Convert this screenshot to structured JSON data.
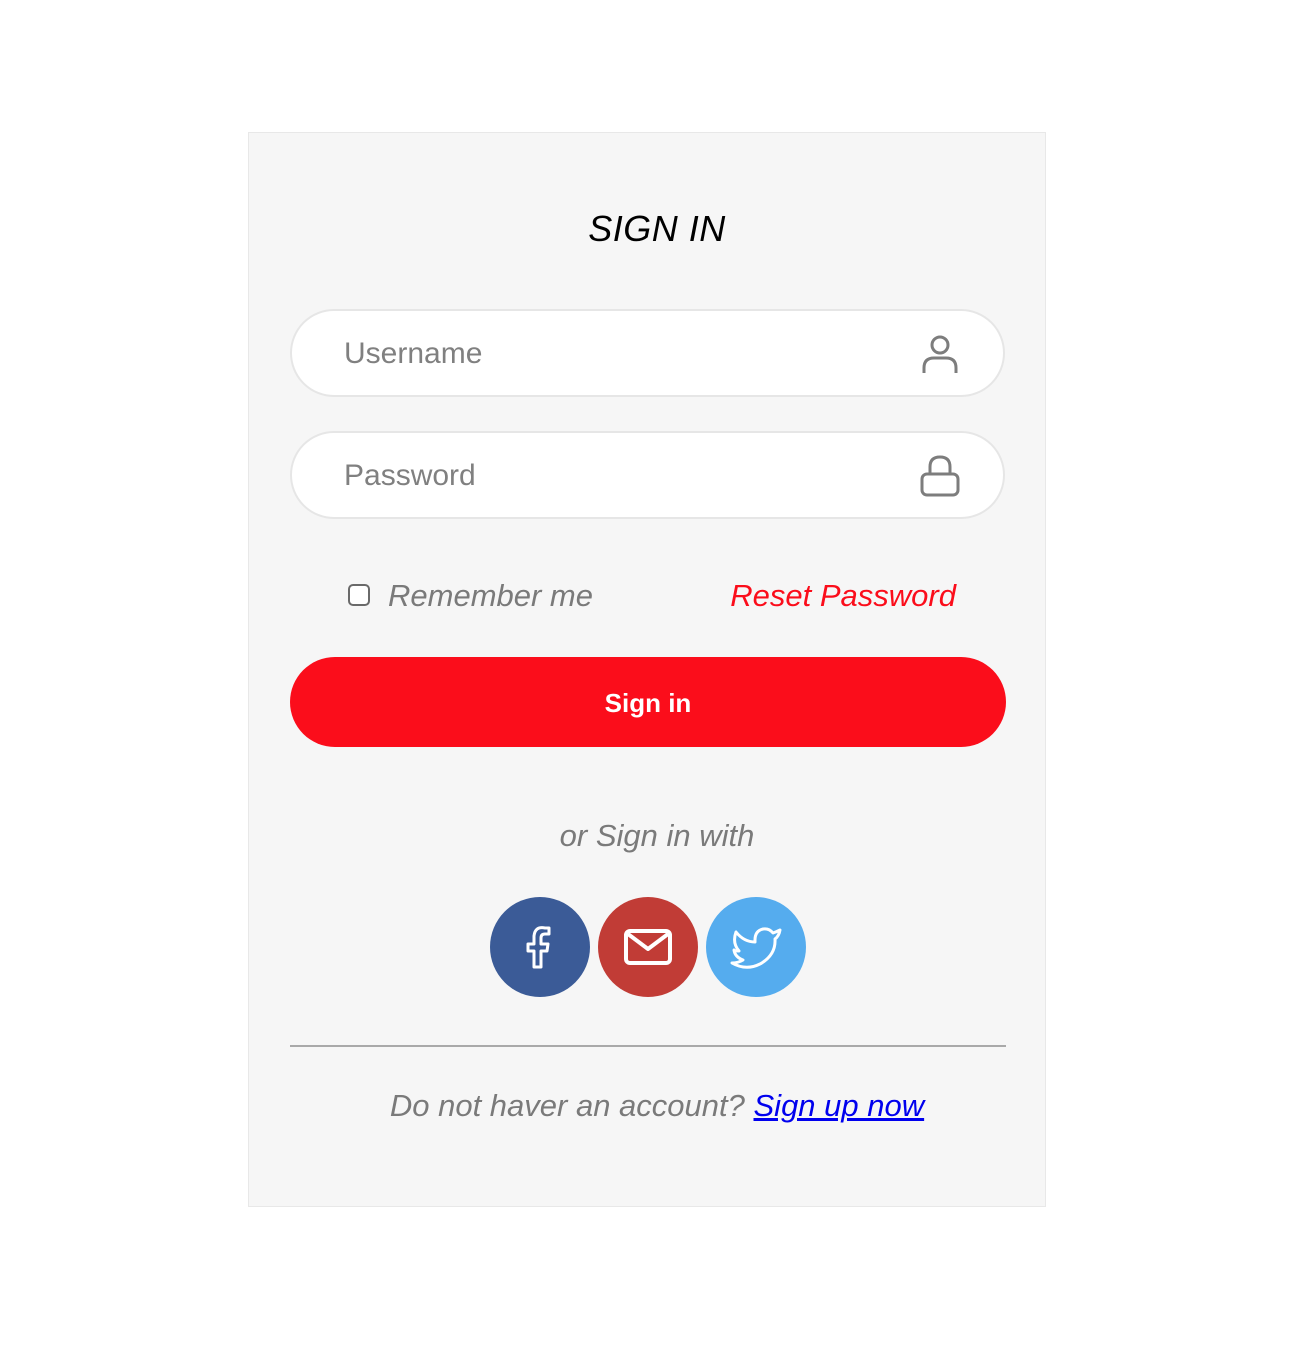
{
  "form": {
    "title": "SIGN IN",
    "username": {
      "placeholder": "Username",
      "icon": "user-icon"
    },
    "password": {
      "placeholder": "Password",
      "icon": "lock-icon"
    },
    "remember_label": "Remember me",
    "remember_checked": false,
    "reset_label": "Reset Password",
    "submit_label": "Sign in",
    "or_label": "or Sign in with",
    "social": [
      {
        "name": "facebook",
        "icon": "facebook-icon",
        "color": "#3b5b97"
      },
      {
        "name": "email",
        "icon": "mail-icon",
        "color": "#c13c36"
      },
      {
        "name": "twitter",
        "icon": "twitter-icon",
        "color": "#55acee"
      }
    ],
    "footer_text": "Do not haver an account? ",
    "signup_label": "Sign up now"
  },
  "colors": {
    "accent": "#fb0d1b",
    "card_bg": "#f6f6f6",
    "link": "#0000ee"
  }
}
